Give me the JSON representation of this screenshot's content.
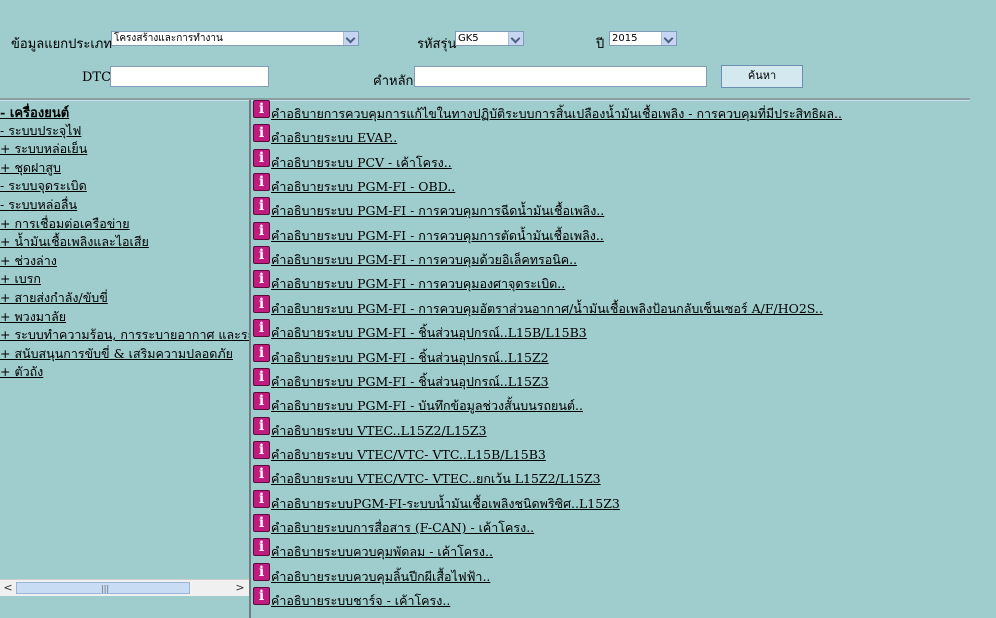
{
  "filter": {
    "category_label": "ข้อมูลแยกประเภท",
    "category_value": "โครงสร้างและการทำงาน",
    "model_label": "รหัสรุ่น",
    "model_value": "GK5",
    "year_label": "ปี",
    "year_value": "2015",
    "dtc_label": "DTC",
    "dtc_value": "",
    "keyword_label": "คำหลัก",
    "keyword_value": "",
    "search_button": "ค้นหา"
  },
  "tree": [
    {
      "label": "- เครื่องยนต์",
      "bold": true
    },
    {
      "label": "- ระบบประจุไฟ"
    },
    {
      "label": "+ ระบบหล่อเย็น"
    },
    {
      "label": "+ ชุดฝาสูบ"
    },
    {
      "label": "- ระบบจุดระเบิด"
    },
    {
      "label": "- ระบบหล่อลื่น"
    },
    {
      "label": "+ การเชื่อมต่อเครือข่าย"
    },
    {
      "label": "+ น้ำมันเชื้อเพลิงและไอเสีย"
    },
    {
      "label": "+ ช่วงล่าง"
    },
    {
      "label": "+ เบรก"
    },
    {
      "label": "+ สายส่งกำลัง/ขับขี่"
    },
    {
      "label": "+ พวงมาลัย"
    },
    {
      "label": "+ ระบบทำความร้อน, การระบายอากาศ และระบบปรับอากาศ"
    },
    {
      "label": "+ สนับสนุนการขับขี่ & เสริมความปลอดภัย"
    },
    {
      "label": "+ ตัวถัง"
    }
  ],
  "scrollbar": {
    "left_arrow": "<",
    "right_arrow": ">",
    "grip": "|||"
  },
  "doc_icon_glyph": "i",
  "documents": [
    "คำอธิบายการควบคุมการแก้ไขในทางปฏิบัติระบบการสิ้นเปลืองน้ำมันเชื้อเพลิง - การควบคุมที่มีประสิทธิผล..",
    "คำอธิบายระบบ EVAP..",
    "คำอธิบายระบบ PCV - เค้าโครง..",
    "คำอธิบายระบบ PGM-FI - OBD..",
    "คำอธิบายระบบ PGM-FI - การควบคุมการฉีดน้ำมันเชื้อเพลิง..",
    "คำอธิบายระบบ PGM-FI - การควบคุมการตัดน้ำมันเชื้อเพลิง..",
    "คำอธิบายระบบ PGM-FI - การควบคุมด้วยอิเล็คทรอนิค..",
    "คำอธิบายระบบ PGM-FI - การควบคุมองศาจุดระเบิด..",
    "คำอธิบายระบบ PGM-FI - การควบคุมอัตราส่วนอากาศ/น้ำมันเชื้อเพลิงป้อนกลับเซ็นเซอร์ A/F/HO2S..",
    "คำอธิบายระบบ PGM-FI - ชิ้นส่วนอุปกรณ์..L15B/L15B3",
    "คำอธิบายระบบ PGM-FI - ชิ้นส่วนอุปกรณ์..L15Z2",
    "คำอธิบายระบบ PGM-FI - ชิ้นส่วนอุปกรณ์..L15Z3",
    "คำอธิบายระบบ PGM-FI - บันทึกข้อมูลช่วงสั้นบนรถยนต์..",
    "คำอธิบายระบบ VTEC..L15Z2/L15Z3",
    "คำอธิบายระบบ VTEC/VTC- VTC..L15B/L15B3",
    "คำอธิบายระบบ VTEC/VTC- VTEC..ยกเว้น L15Z2/L15Z3",
    "คำอธิบายระบบPGM-FI-ระบบน้ำมันเชื้อเพลิงชนิดพริซิศ..L15Z3",
    "คำอธิบายระบบการสื่อสาร (F-CAN) - เค้าโครง..",
    "คำอธิบายระบบควบคุมพัดลม - เค้าโครง..",
    "คำอธิบายระบบควบคุมลิ้นปีกผีเสื้อไฟฟ้า..",
    "คำอธิบายระบบชาร์จ - เค้าโครง.."
  ]
}
